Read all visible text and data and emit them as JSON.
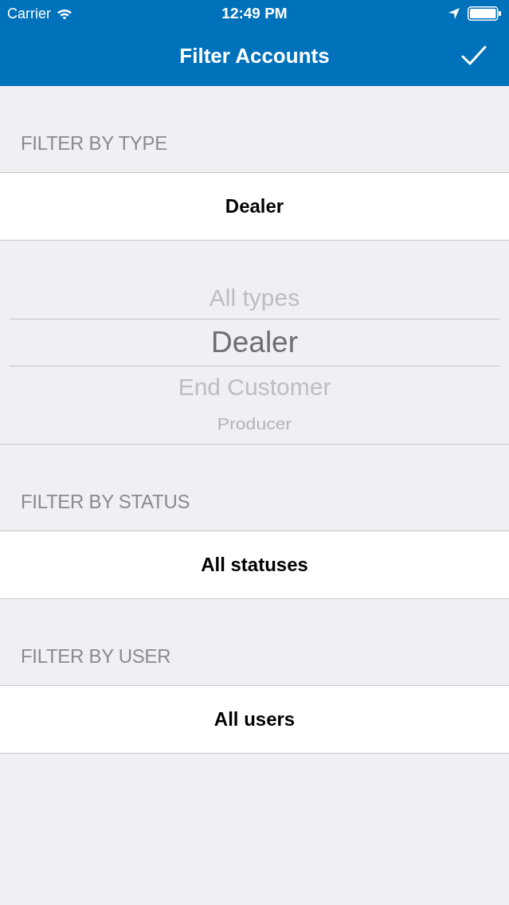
{
  "status_bar": {
    "carrier": "Carrier",
    "time": "12:49 PM"
  },
  "nav_bar": {
    "title": "Filter Accounts"
  },
  "sections": [
    {
      "header": "FILTER BY TYPE",
      "value": "Dealer",
      "picker": {
        "options": [
          {
            "label": "All types",
            "selected": false
          },
          {
            "label": "Dealer",
            "selected": true
          },
          {
            "label": "End Customer",
            "selected": false
          },
          {
            "label": "Producer",
            "selected": false
          }
        ]
      }
    },
    {
      "header": "FILTER BY STATUS",
      "value": "All statuses"
    },
    {
      "header": "FILTER BY USER",
      "value": "All users"
    }
  ]
}
